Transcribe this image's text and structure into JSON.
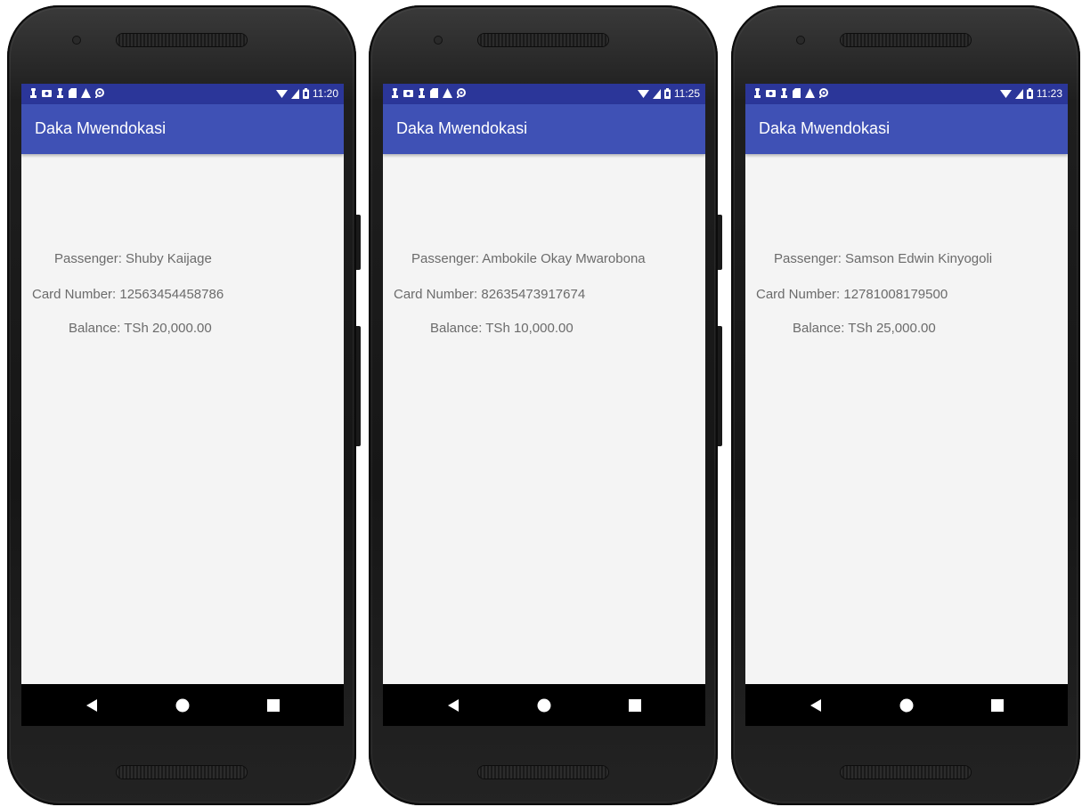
{
  "app": {
    "title": "Daka Mwendokasi"
  },
  "status_icons": [
    "lock-icon",
    "photo-icon",
    "lock-icon",
    "sd-card-icon",
    "warning-icon",
    "location-icon"
  ],
  "navigation": [
    "back-icon",
    "home-icon",
    "recents-icon"
  ],
  "colors": {
    "status_bar": "#2b3699",
    "app_bar": "#3f51b5",
    "screen_background": "#f4f4f4",
    "body_text": "#6b6b6b"
  },
  "phones": [
    {
      "status": {
        "time": "11:20"
      },
      "passenger": "Passenger: Shuby Kaijage",
      "card_number": "Card Number: 12563454458786",
      "balance": "Balance: TSh 20,000.00"
    },
    {
      "status": {
        "time": "11:25"
      },
      "passenger": "Passenger: Ambokile Okay Mwarobona",
      "card_number": "Card Number: 82635473917674",
      "balance": "Balance: TSh 10,000.00"
    },
    {
      "status": {
        "time": "11:23"
      },
      "passenger": "Passenger: Samson Edwin Kinyogoli",
      "card_number": "Card Number: 12781008179500",
      "balance": "Balance: TSh 25,000.00"
    }
  ]
}
